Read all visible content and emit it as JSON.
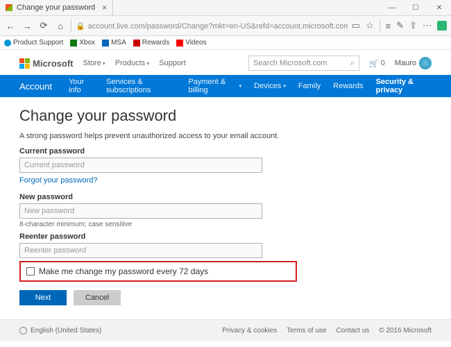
{
  "window": {
    "tab_title": "Change your password",
    "url": "account.live.com/password/Change?mkt=en-US&refd=account.microsoft.com&refp=privacy"
  },
  "favorites": [
    "Product Support",
    "Xbox",
    "MSA",
    "Rewards",
    "Videos"
  ],
  "header": {
    "brand": "Microsoft",
    "menu": [
      "Store",
      "Products",
      "Support"
    ],
    "search_placeholder": "Search Microsoft.com",
    "cart_count": "0",
    "username": "Mauro"
  },
  "nav": {
    "brand": "Account",
    "items": [
      {
        "label": "Your info",
        "dropdown": false
      },
      {
        "label": "Services & subscriptions",
        "dropdown": false
      },
      {
        "label": "Payment & billing",
        "dropdown": true
      },
      {
        "label": "Devices",
        "dropdown": true
      },
      {
        "label": "Family",
        "dropdown": false
      },
      {
        "label": "Rewards",
        "dropdown": false
      },
      {
        "label": "Security & privacy",
        "dropdown": false,
        "active": true
      }
    ]
  },
  "form": {
    "title": "Change your password",
    "desc": "A strong password helps prevent unauthorized access to your email account.",
    "current_label": "Current password",
    "current_placeholder": "Current password",
    "forgot_link": "Forgot your password?",
    "new_label": "New password",
    "new_placeholder": "New password",
    "hint": "8-character minimum; case sensitive",
    "reenter_label": "Reenter password",
    "reenter_placeholder": "Reenter password",
    "checkbox_label": "Make me change my password every 72 days",
    "next": "Next",
    "cancel": "Cancel"
  },
  "footer": {
    "lang": "English (United States)",
    "links": [
      "Privacy & cookies",
      "Terms of use",
      "Contact us"
    ],
    "copyright": "© 2016 Microsoft"
  }
}
